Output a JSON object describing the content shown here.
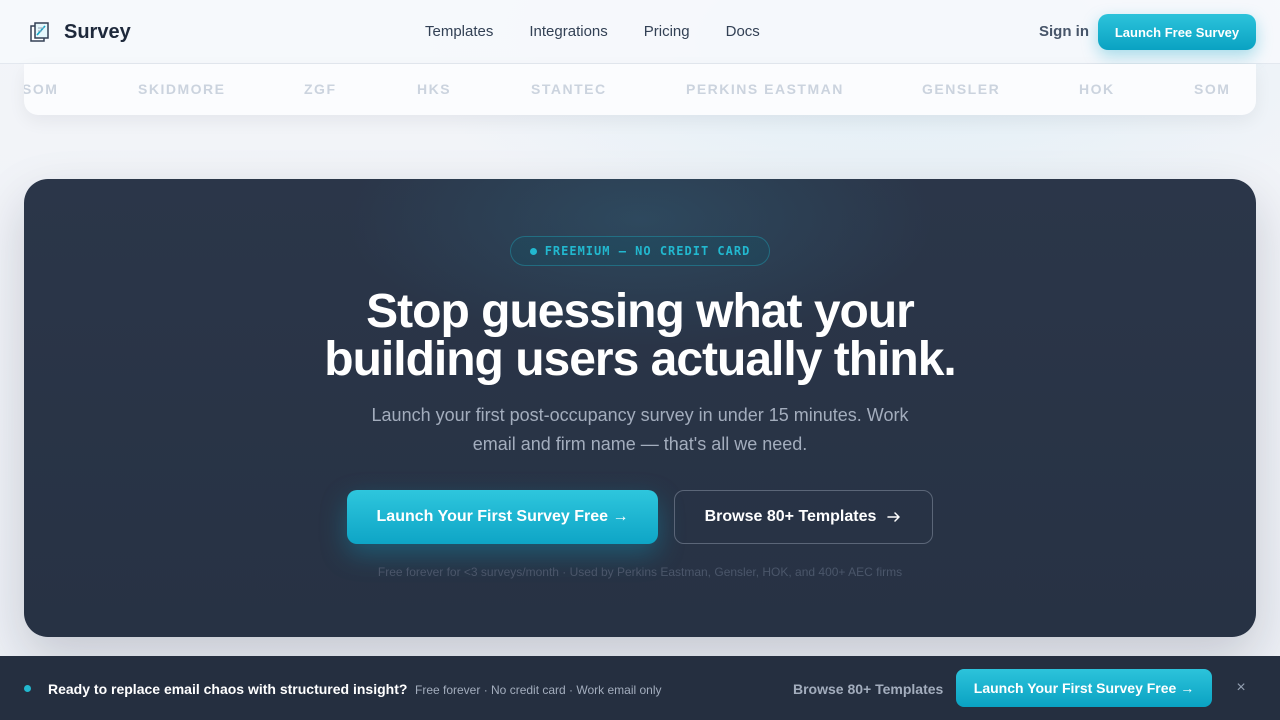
{
  "nav": {
    "brand": "Survey",
    "links": [
      "Templates",
      "Integrations",
      "Pricing",
      "Docs"
    ],
    "signin": "Sign in",
    "cta": "Launch Free Survey"
  },
  "logos": [
    "SOM",
    "SKIDMORE",
    "ZGF",
    "HKS",
    "STANTEC",
    "PERKINS EASTMAN",
    "GENSLER",
    "HOK",
    "SOM"
  ],
  "hero": {
    "badge": "FREEMIUM — NO CREDIT CARD",
    "headline_line1": "Stop guessing what your",
    "headline_line2": "building users actually think.",
    "subline": "Launch your first post-occupancy survey in under 15 minutes. Work email and firm name — that's all we need.",
    "primary_cta": "Launch Your First Survey Free →",
    "secondary_cta": "Browse 80+ Templates",
    "fineprint": "Free forever for <3 surveys/month · Used by Perkins Eastman, Gensler, HOK, and 400+ AEC firms"
  },
  "sticky": {
    "message": "Ready to replace email chaos with structured insight?",
    "meta": "Free forever · No credit card · Work email only",
    "browse": "Browse 80+ Templates",
    "cta": "Launch Your First Survey Free →",
    "close": "×"
  },
  "colors": {
    "accent": "#22b8cf",
    "hero_bg": "#2b3649",
    "sticky_bg": "#252f40"
  }
}
